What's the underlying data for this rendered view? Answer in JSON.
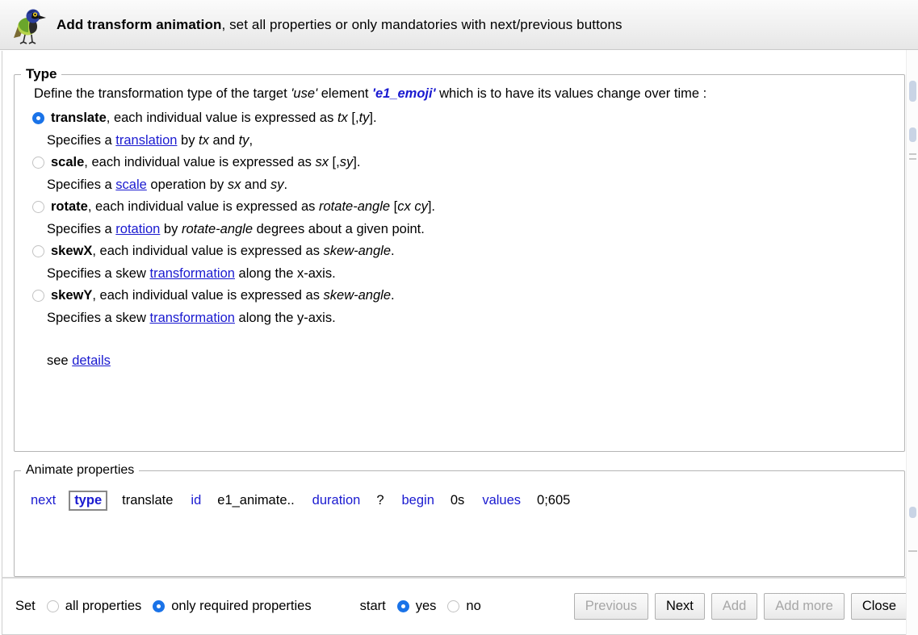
{
  "header": {
    "icon": "bird-logo-icon",
    "title_bold": "Add transform animation",
    "title_rest": ", set all properties or only mandatories with next/previous buttons"
  },
  "type_panel": {
    "legend": "Type",
    "intro": {
      "part1": "Define the transformation type of the target ",
      "target_kind": "'use'",
      "part2": " element ",
      "target_id": "'e1_emoji'",
      "part3": " which is to have its values change over time :"
    },
    "options": [
      {
        "id": "translate",
        "selected": true,
        "name": "translate",
        "label_rest": ", each individual value is expressed as ",
        "syntax_italic": "tx",
        "syntax_rest": " [,",
        "syntax_italic2": "ty",
        "syntax_end": "].",
        "desc_pre": "Specifies a ",
        "desc_link": "translation",
        "desc_mid": " by ",
        "desc_it1": "tx",
        "desc_mid2": " and ",
        "desc_it2": "ty",
        "desc_end": ","
      },
      {
        "id": "scale",
        "selected": false,
        "name": "scale",
        "label_rest": ", each individual value is expressed as ",
        "syntax_italic": "sx",
        "syntax_rest": " [,",
        "syntax_italic2": "sy",
        "syntax_end": "].",
        "desc_pre": "Specifies a ",
        "desc_link": "scale",
        "desc_mid": " operation by ",
        "desc_it1": "sx",
        "desc_mid2": " and ",
        "desc_it2": "sy",
        "desc_end": "."
      },
      {
        "id": "rotate",
        "selected": false,
        "name": "rotate",
        "label_rest": ", each individual value is expressed as ",
        "syntax_italic": "rotate-angle",
        "syntax_rest": " [",
        "syntax_italic2": "cx cy",
        "syntax_end": "].",
        "desc_pre": "Specifies a ",
        "desc_link": "rotation",
        "desc_mid": " by ",
        "desc_it1": "rotate-angle",
        "desc_mid2": " degrees about a given point",
        "desc_it2": "",
        "desc_end": "."
      },
      {
        "id": "skewX",
        "selected": false,
        "name": "skewX",
        "label_rest": ", each individual value is expressed as ",
        "syntax_italic": "skew-angle",
        "syntax_rest": "",
        "syntax_italic2": "",
        "syntax_end": ".",
        "desc_pre": "Specifies a skew ",
        "desc_link": "transformation",
        "desc_mid": " along the x-axis",
        "desc_it1": "",
        "desc_mid2": "",
        "desc_it2": "",
        "desc_end": "."
      },
      {
        "id": "skewY",
        "selected": false,
        "name": "skewY",
        "label_rest": ", each individual value is expressed as ",
        "syntax_italic": "skew-angle",
        "syntax_rest": "",
        "syntax_italic2": "",
        "syntax_end": ".",
        "desc_pre": "Specifies a skew ",
        "desc_link": "transformation",
        "desc_mid": " along the y-axis",
        "desc_it1": "",
        "desc_mid2": "",
        "desc_it2": "",
        "desc_end": "."
      }
    ],
    "see_text": "see ",
    "see_link": "details"
  },
  "animate_panel": {
    "legend": "Animate properties",
    "items": [
      {
        "label": "next",
        "value": "",
        "boxed": false
      },
      {
        "label": "type",
        "value": "translate",
        "boxed": true
      },
      {
        "label": "id",
        "value": "e1_animate..",
        "boxed": false
      },
      {
        "label": "duration",
        "value": "?",
        "boxed": false
      },
      {
        "label": "begin",
        "value": "0s",
        "boxed": false
      },
      {
        "label": "values",
        "value": "0;605",
        "boxed": false
      }
    ]
  },
  "footer": {
    "set_label": "Set",
    "set_options": [
      {
        "label": "all properties",
        "selected": false
      },
      {
        "label": "only required properties",
        "selected": true
      }
    ],
    "start_label": "start",
    "start_options": [
      {
        "label": "yes",
        "selected": true
      },
      {
        "label": "no",
        "selected": false
      }
    ],
    "buttons": [
      {
        "label": "Previous",
        "disabled": true
      },
      {
        "label": "Next",
        "disabled": false
      },
      {
        "label": "Add",
        "disabled": true
      },
      {
        "label": "Add more",
        "disabled": true
      },
      {
        "label": "Close",
        "disabled": false
      }
    ]
  },
  "colors": {
    "link": "#1a1ad0",
    "radio_on": "#1a73e8",
    "panel_border": "#b5b5b5",
    "header_bg": "#f0f0f0"
  }
}
